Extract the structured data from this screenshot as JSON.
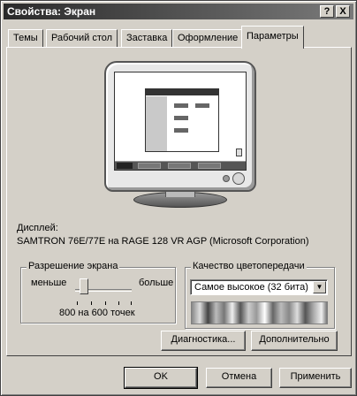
{
  "window": {
    "title": "Свойства: Экран",
    "help_label": "?",
    "close_label": "X"
  },
  "tabs": [
    {
      "label": "Темы"
    },
    {
      "label": "Рабочий стол"
    },
    {
      "label": "Заставка"
    },
    {
      "label": "Оформление"
    },
    {
      "label": "Параметры",
      "active": true
    }
  ],
  "display": {
    "label": "Дисплей:",
    "name": "SAMTRON 76E/77E на RAGE 128 VR AGP (Microsoft Corporation)"
  },
  "resolution": {
    "legend": "Разрешение экрана",
    "less": "меньше",
    "more": "больше",
    "value_text": "800 на 600 точек",
    "slider_level": 0.1
  },
  "color_quality": {
    "legend": "Качество цветопередачи",
    "selected": "Самое высокое (32 бита)"
  },
  "buttons": {
    "troubleshoot": "Диагностика...",
    "advanced": "Дополнительно",
    "ok": "OK",
    "cancel": "Отмена",
    "apply": "Применить"
  },
  "icons": {
    "close": "close-icon",
    "help": "help-icon",
    "dropdown": "chevron-down-icon"
  }
}
